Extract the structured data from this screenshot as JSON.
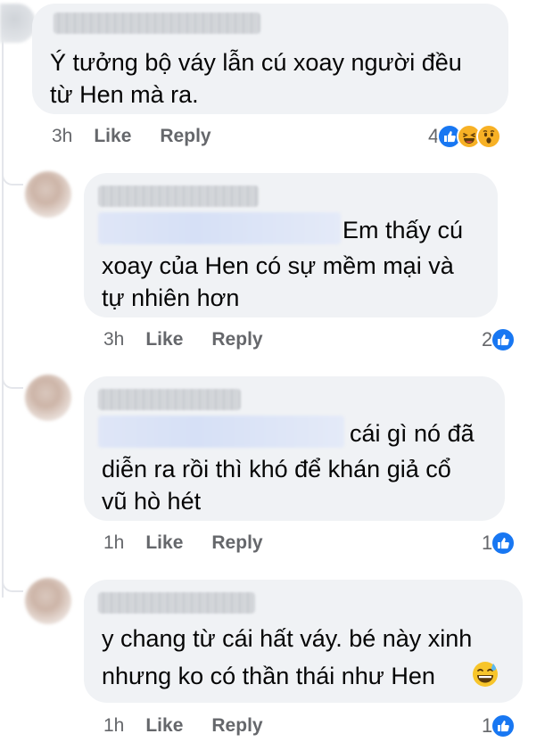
{
  "comments": [
    {
      "text_lines": [
        "Ý tưởng bộ váy lẫn cú xoay người đều",
        "từ Hen mà ra."
      ],
      "time": "3h",
      "like": "Like",
      "reply": "Reply",
      "reaction_count": "4",
      "reactions": [
        "like-icon",
        "haha-icon",
        "wow-icon"
      ]
    },
    {
      "text_lines": [
        "Em thấy cú",
        "xoay của Hen có sự mềm mại và",
        "tự nhiên hơn"
      ],
      "time": "3h",
      "like": "Like",
      "reply": "Reply",
      "reaction_count": "2",
      "reactions": [
        "like-icon"
      ]
    },
    {
      "text_lines": [
        "cái gì nó đã",
        "diễn ra rồi thì khó để khán giả cổ",
        "vũ hò hét"
      ],
      "time": "1h",
      "like": "Like",
      "reply": "Reply",
      "reaction_count": "1",
      "reactions": [
        "like-icon"
      ]
    },
    {
      "text_lines": [
        "y chang từ cái hất váy. bé này xinh",
        "nhưng ko có thần thái như Hen"
      ],
      "emoji": "sweat-smile-emoji",
      "time": "1h",
      "like": "Like",
      "reply": "Reply",
      "reaction_count": "1",
      "reactions": [
        "like-icon"
      ]
    }
  ],
  "colors": {
    "bubble": "#f0f2f5",
    "meta": "#65676b",
    "like_blue": "#1877f2",
    "emoji_yellow": "#f7b125"
  }
}
